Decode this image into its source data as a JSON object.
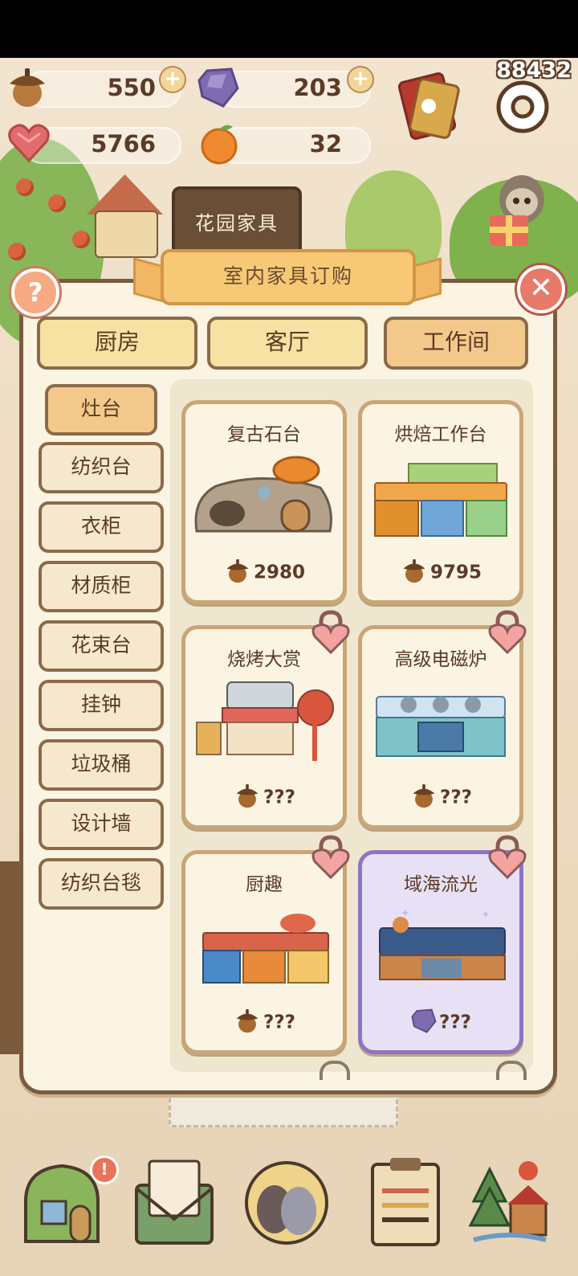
{
  "score": "88432",
  "resources": {
    "acorn": {
      "value": "550",
      "icon": "acorn-icon"
    },
    "crystal": {
      "value": "203",
      "icon": "purple-crystal-icon"
    },
    "heart_gem": {
      "value": "5766",
      "icon": "heart-gem-icon"
    },
    "orange": {
      "value": "32",
      "icon": "orange-fruit-icon"
    }
  },
  "background": {
    "garden_sign": "花园家具"
  },
  "modal": {
    "title": "室内家具订购",
    "categories": [
      {
        "label": "厨房",
        "active": false
      },
      {
        "label": "客厅",
        "active": false
      },
      {
        "label": "工作间",
        "active": true
      }
    ],
    "subnav": [
      {
        "label": "灶台",
        "active": true
      },
      {
        "label": "纺织台",
        "active": false
      },
      {
        "label": "衣柜",
        "active": false
      },
      {
        "label": "材质柜",
        "active": false
      },
      {
        "label": "花束台",
        "active": false
      },
      {
        "label": "挂钟",
        "active": false
      },
      {
        "label": "垃圾桶",
        "active": false
      },
      {
        "label": "设计墙",
        "active": false
      },
      {
        "label": "纺织台毯",
        "active": false
      }
    ],
    "items": [
      {
        "name": "复古石台",
        "price": "2980",
        "currency": "acorn",
        "locked": false,
        "special": false
      },
      {
        "name": "烘焙工作台",
        "price": "9795",
        "currency": "acorn",
        "locked": false,
        "special": false
      },
      {
        "name": "烧烤大赏",
        "price": "???",
        "currency": "acorn",
        "locked": true,
        "special": false
      },
      {
        "name": "高级电磁炉",
        "price": "???",
        "currency": "acorn",
        "locked": true,
        "special": false
      },
      {
        "name": "厨趣",
        "price": "???",
        "currency": "acorn",
        "locked": true,
        "special": false
      },
      {
        "name": "域海流光",
        "price": "???",
        "currency": "crystal",
        "locked": true,
        "special": true
      }
    ]
  },
  "colors": {
    "brown_outline": "#7a5a3e",
    "card_bg": "#fbf4e2",
    "tab_yellow": "#f6e3a3",
    "tab_active": "#f3c98b",
    "special_border": "#8f74c1",
    "lock_pink": "#f3a3a0"
  }
}
